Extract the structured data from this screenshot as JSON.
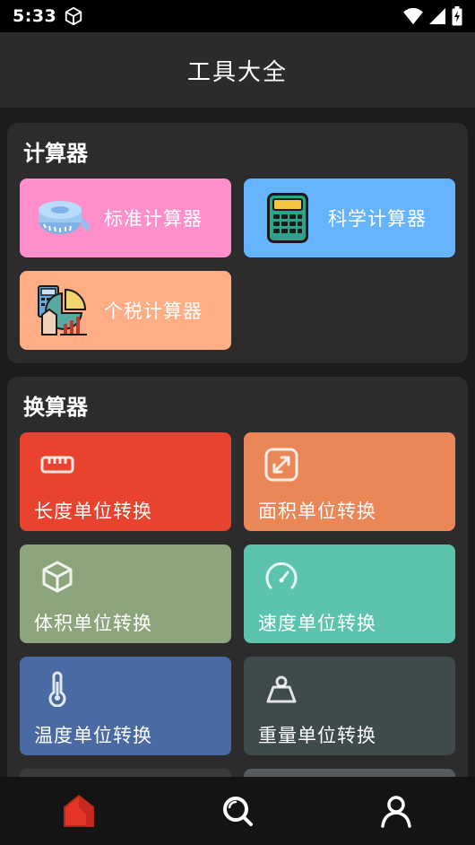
{
  "status_bar": {
    "time": "5:33"
  },
  "header": {
    "title": "工具大全"
  },
  "calculators": {
    "title": "计算器",
    "items": [
      {
        "label": "标准计算器",
        "icon": "tape-measure-icon",
        "color": "#ff8fcb"
      },
      {
        "label": "科学计算器",
        "icon": "calculator-icon",
        "color": "#66b3ff"
      },
      {
        "label": "个税计算器",
        "icon": "tax-chart-icon",
        "color": "#ffad85"
      }
    ]
  },
  "converters": {
    "title": "换算器",
    "items": [
      {
        "label": "长度单位转换",
        "icon": "ruler-icon",
        "color": "#e8432f"
      },
      {
        "label": "面积单位转换",
        "icon": "resize-icon",
        "color": "#eb8757"
      },
      {
        "label": "体积单位转换",
        "icon": "cube-icon",
        "color": "#8da57d"
      },
      {
        "label": "速度单位转换",
        "icon": "speedometer-icon",
        "color": "#5cc4ae"
      },
      {
        "label": "温度单位转换",
        "icon": "thermometer-icon",
        "color": "#4a6aa3"
      },
      {
        "label": "重量单位转换",
        "icon": "weight-icon",
        "color": "#3e4a4c"
      }
    ]
  },
  "bottom_nav": {
    "items": [
      {
        "icon": "home-icon",
        "active": true,
        "color": "#e53528"
      },
      {
        "icon": "search-icon",
        "active": false
      },
      {
        "icon": "profile-icon",
        "active": false
      }
    ]
  }
}
